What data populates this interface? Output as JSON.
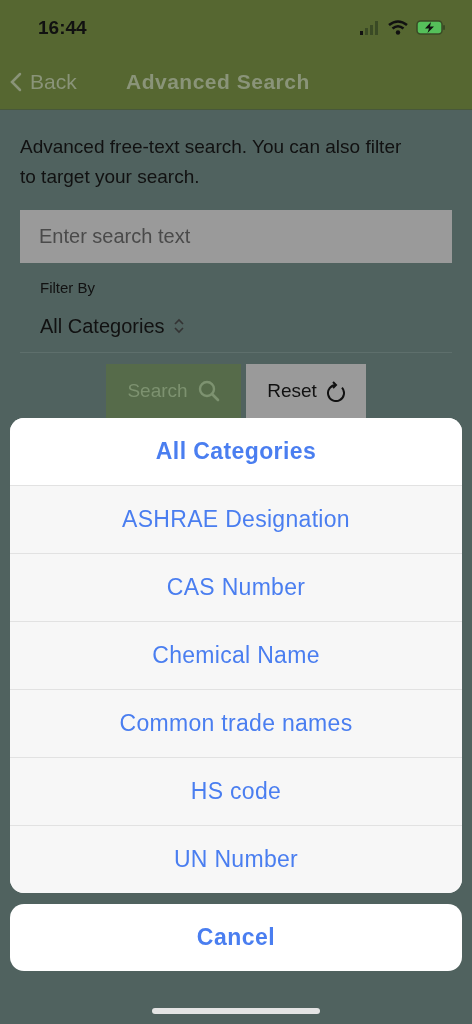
{
  "status_bar": {
    "time": "16:44"
  },
  "nav_bar": {
    "back": "Back",
    "title": "Advanced Search"
  },
  "intro": "Advanced free-text search. You can also filter to target your search.",
  "search_field": {
    "placeholder": "Enter search text"
  },
  "filter": {
    "label": "Filter By",
    "value": "All Categories"
  },
  "buttons": [
    {
      "kind": "search",
      "label": "Search"
    },
    {
      "kind": "reset",
      "label": "Reset"
    }
  ],
  "action_sheet": {
    "title": "All Categories",
    "options": [
      "ASHRAE Designation",
      "CAS Number",
      "Chemical Name",
      "Common trade names",
      "HS code",
      "UN Number"
    ],
    "cancel": "Cancel"
  }
}
